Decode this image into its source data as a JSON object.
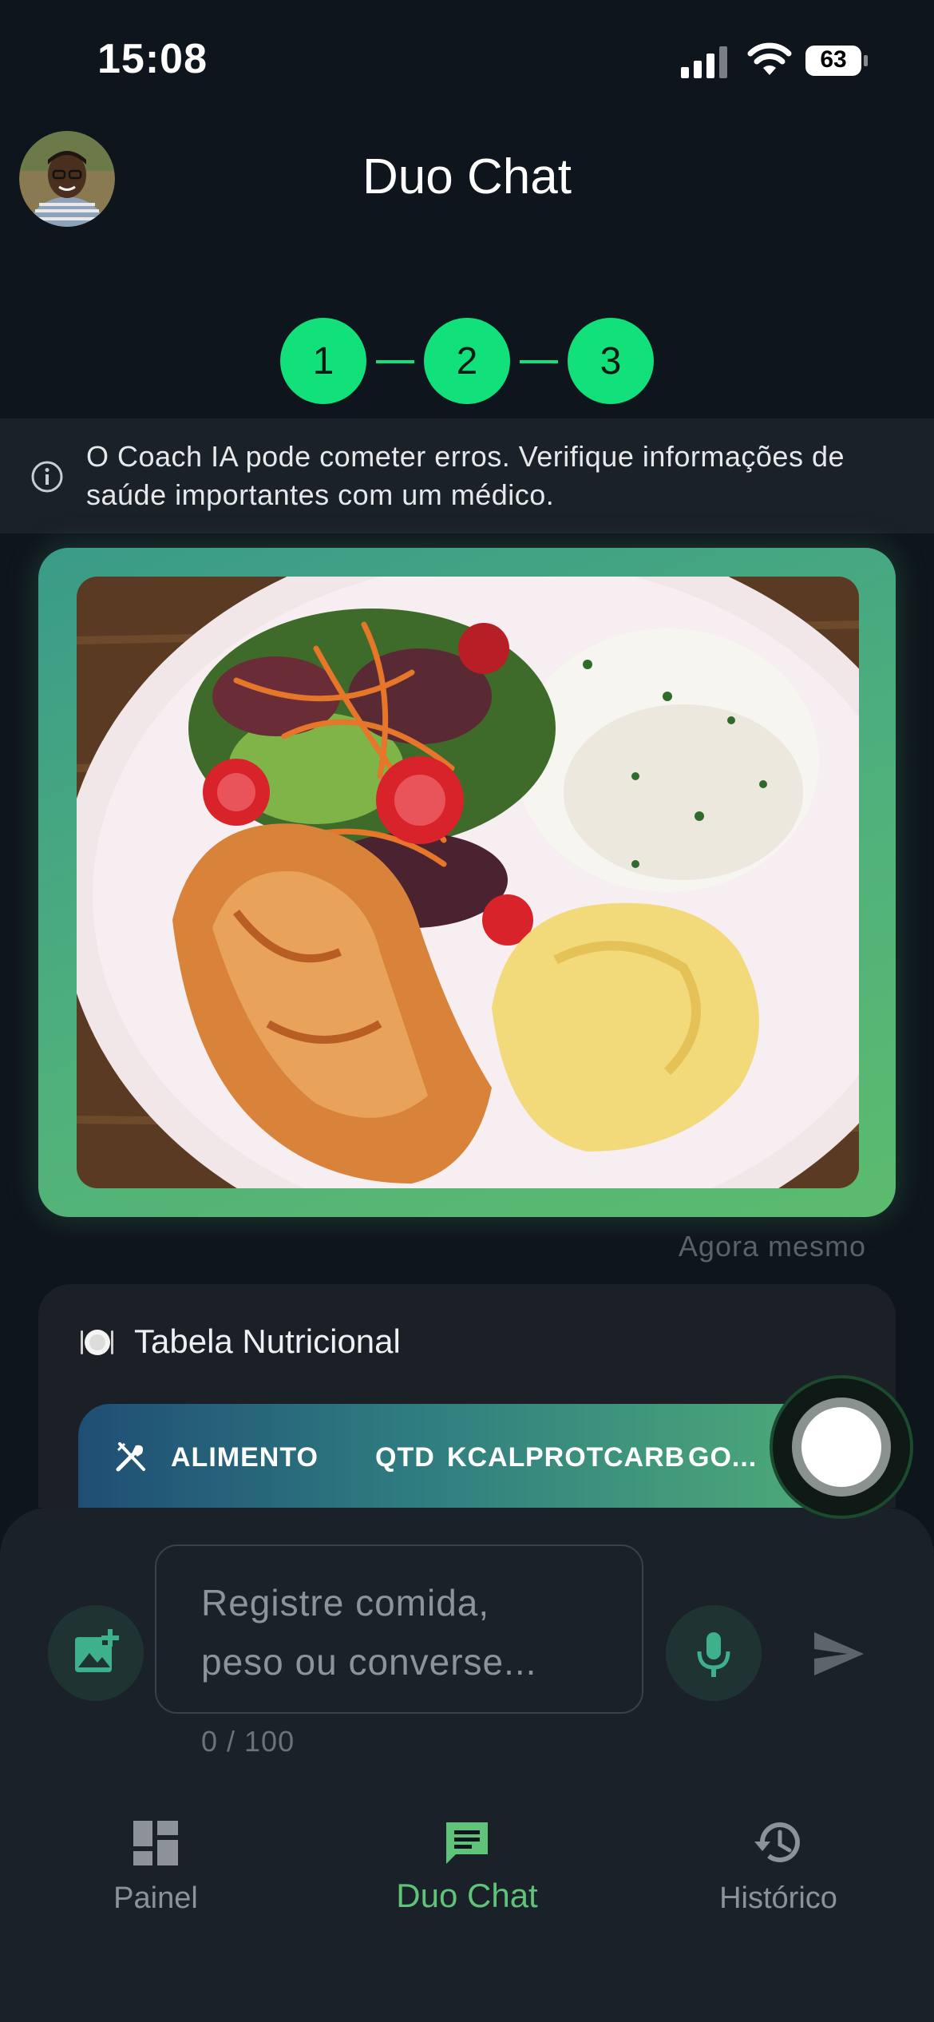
{
  "status_bar": {
    "time": "15:08",
    "battery": "63"
  },
  "header": {
    "title": "Duo Chat"
  },
  "steps": [
    "1",
    "2",
    "3"
  ],
  "disclaimer": {
    "text": "O Coach IA pode cometer erros. Verifique informações de saúde importantes com um médico."
  },
  "message": {
    "timestamp": "Agora mesmo"
  },
  "nutrition": {
    "title": "Tabela Nutricional",
    "columns": [
      "ALIMENTO",
      "QTD",
      "KCAL",
      "PROT",
      "CARB",
      "GO..."
    ]
  },
  "composer": {
    "placeholder_line1": "Registre comida,",
    "placeholder_line2": "peso ou converse...",
    "counter": "0 / 100"
  },
  "nav": {
    "items": [
      {
        "label": "Painel",
        "icon": "dashboard-icon"
      },
      {
        "label": "Duo Chat",
        "icon": "chat-icon",
        "active": true
      },
      {
        "label": "Histórico",
        "icon": "history-icon"
      }
    ]
  },
  "colors": {
    "accent": "#12e07a",
    "active_nav": "#5fc47a",
    "background": "#0f151c"
  }
}
